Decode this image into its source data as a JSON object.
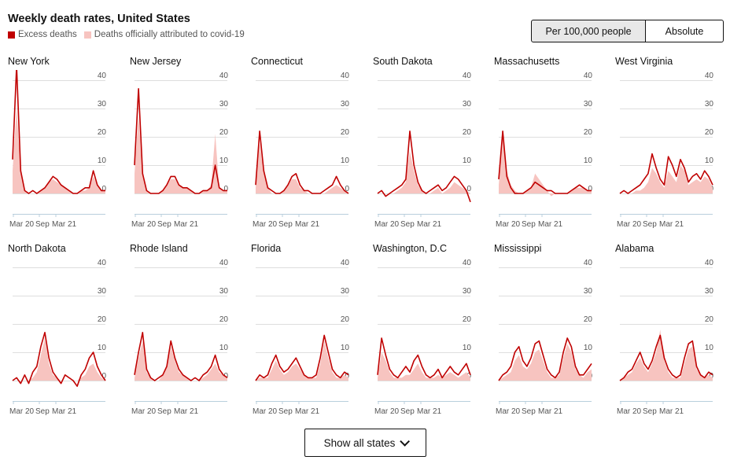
{
  "title": "Weekly death rates, United States",
  "legend": {
    "excess_label": "Excess deaths",
    "official_label": "Deaths officially attributed to covid-19"
  },
  "colors": {
    "excess": "#c00000",
    "official": "#f7c4c0",
    "grid": "#dedede",
    "axis": "#b9cfdc"
  },
  "toggle": {
    "per_label": "Per 100,000 people",
    "abs_label": "Absolute",
    "selected": "per"
  },
  "show_all_label": "Show all states",
  "chart_data": {
    "type": "line",
    "xlabel": "",
    "ylabel": "",
    "ylim": [
      -3,
      40
    ],
    "yticks": [
      0,
      10,
      20,
      30,
      40
    ],
    "xticks": [
      "Mar 20",
      "Sep",
      "Mar 21"
    ],
    "x": [
      "2020-03",
      "2020-04",
      "2020-05",
      "2020-06",
      "2020-07",
      "2020-08",
      "2020-09",
      "2020-10",
      "2020-11",
      "2020-12",
      "2021-01",
      "2021-02",
      "2021-03",
      "2021-04",
      "2021-05",
      "2021-06",
      "2021-07",
      "2021-08",
      "2021-09",
      "2021-10",
      "2021-11",
      "2021-12",
      "2022-01",
      "2022-02"
    ],
    "panels": [
      {
        "name": "New York",
        "series": [
          {
            "name": "Excess deaths",
            "values": [
              12,
              45,
              8,
              1,
              0,
              1,
              0,
              1,
              2,
              4,
              6,
              5,
              3,
              2,
              1,
              0,
              0,
              1,
              2,
              2,
              8,
              3,
              1,
              1
            ]
          },
          {
            "name": "Deaths officially attributed to covid-19",
            "values": [
              8,
              30,
              7,
              1,
              0,
              0,
              0,
              1,
              2,
              4,
              5,
              4,
              3,
              2,
              1,
              0,
              0,
              1,
              1,
              2,
              6,
              3,
              1,
              1
            ]
          }
        ]
      },
      {
        "name": "New Jersey",
        "series": [
          {
            "name": "Excess deaths",
            "values": [
              10,
              37,
              7,
              1,
              0,
              0,
              0,
              1,
              3,
              6,
              6,
              3,
              2,
              2,
              1,
              0,
              0,
              1,
              1,
              2,
              10,
              2,
              1,
              1
            ]
          },
          {
            "name": "Deaths officially attributed to covid-19",
            "values": [
              7,
              28,
              6,
              1,
              0,
              0,
              0,
              1,
              3,
              5,
              5,
              3,
              2,
              2,
              1,
              0,
              0,
              1,
              1,
              3,
              21,
              2,
              1,
              1
            ]
          }
        ]
      },
      {
        "name": "Connecticut",
        "series": [
          {
            "name": "Excess deaths",
            "values": [
              3,
              22,
              8,
              2,
              1,
              0,
              0,
              1,
              3,
              6,
              7,
              3,
              1,
              1,
              0,
              0,
              0,
              1,
              2,
              3,
              6,
              3,
              1,
              0
            ]
          },
          {
            "name": "Deaths officially attributed to covid-19",
            "values": [
              2,
              18,
              7,
              2,
              0,
              0,
              0,
              1,
              3,
              5,
              5,
              2,
              1,
              0,
              0,
              0,
              0,
              0,
              1,
              2,
              3,
              2,
              1,
              0
            ]
          }
        ]
      },
      {
        "name": "South Dakota",
        "series": [
          {
            "name": "Excess deaths",
            "values": [
              0,
              1,
              -1,
              0,
              1,
              2,
              3,
              5,
              22,
              10,
              4,
              1,
              0,
              1,
              2,
              3,
              1,
              2,
              4,
              6,
              5,
              3,
              1,
              -3
            ]
          },
          {
            "name": "Deaths officially attributed to covid-19",
            "values": [
              0,
              0,
              0,
              0,
              0,
              1,
              2,
              4,
              15,
              8,
              3,
              1,
              0,
              0,
              1,
              2,
              0,
              1,
              2,
              4,
              3,
              2,
              1,
              0
            ]
          }
        ]
      },
      {
        "name": "Massachusetts",
        "series": [
          {
            "name": "Excess deaths",
            "values": [
              5,
              22,
              6,
              2,
              0,
              0,
              0,
              1,
              2,
              4,
              3,
              2,
              1,
              1,
              0,
              0,
              0,
              0,
              1,
              2,
              3,
              2,
              1,
              1
            ]
          },
          {
            "name": "Deaths officially attributed to covid-19",
            "values": [
              3,
              20,
              8,
              3,
              1,
              0,
              0,
              1,
              2,
              7,
              5,
              3,
              1,
              -1,
              0,
              0,
              0,
              0,
              1,
              2,
              2,
              2,
              1,
              1
            ]
          }
        ]
      },
      {
        "name": "West Virginia",
        "series": [
          {
            "name": "Excess deaths",
            "values": [
              0,
              1,
              0,
              1,
              2,
              3,
              5,
              7,
              14,
              9,
              5,
              3,
              13,
              10,
              6,
              12,
              9,
              4,
              6,
              7,
              5,
              8,
              6,
              3
            ]
          },
          {
            "name": "Deaths officially attributed to covid-19",
            "values": [
              0,
              0,
              0,
              0,
              1,
              1,
              2,
              4,
              9,
              7,
              4,
              2,
              8,
              6,
              4,
              10,
              8,
              3,
              4,
              5,
              4,
              6,
              5,
              2
            ]
          }
        ]
      },
      {
        "name": "North Dakota",
        "series": [
          {
            "name": "Excess deaths",
            "values": [
              0,
              1,
              -1,
              2,
              -1,
              3,
              5,
              12,
              17,
              8,
              3,
              1,
              -1,
              2,
              1,
              0,
              -2,
              2,
              4,
              8,
              10,
              5,
              2,
              0
            ]
          },
          {
            "name": "Deaths officially attributed to covid-19",
            "values": [
              0,
              0,
              0,
              0,
              0,
              1,
              3,
              9,
              15,
              6,
              2,
              1,
              0,
              0,
              0,
              0,
              0,
              1,
              2,
              5,
              6,
              3,
              1,
              0
            ]
          }
        ]
      },
      {
        "name": "Rhode Island",
        "series": [
          {
            "name": "Excess deaths",
            "values": [
              2,
              10,
              17,
              4,
              1,
              0,
              1,
              2,
              5,
              14,
              8,
              4,
              2,
              1,
              0,
              1,
              0,
              2,
              3,
              5,
              9,
              4,
              2,
              1
            ]
          },
          {
            "name": "Deaths officially attributed to covid-19",
            "values": [
              1,
              8,
              14,
              3,
              1,
              0,
              0,
              2,
              5,
              12,
              7,
              3,
              2,
              1,
              0,
              0,
              0,
              1,
              2,
              4,
              6,
              3,
              2,
              1
            ]
          }
        ]
      },
      {
        "name": "Florida",
        "series": [
          {
            "name": "Excess deaths",
            "values": [
              0,
              2,
              1,
              2,
              6,
              9,
              5,
              3,
              4,
              6,
              8,
              5,
              2,
              1,
              1,
              2,
              8,
              16,
              10,
              4,
              2,
              1,
              3,
              2
            ]
          },
          {
            "name": "Deaths officially attributed to covid-19",
            "values": [
              0,
              1,
              1,
              1,
              4,
              7,
              4,
              2,
              3,
              5,
              6,
              4,
              2,
              1,
              1,
              1,
              6,
              14,
              8,
              3,
              1,
              1,
              2,
              1
            ]
          }
        ]
      },
      {
        "name": "Washington, D.C",
        "series": [
          {
            "name": "Excess deaths",
            "values": [
              2,
              15,
              9,
              4,
              2,
              1,
              3,
              5,
              3,
              7,
              9,
              5,
              2,
              1,
              2,
              4,
              1,
              3,
              5,
              3,
              2,
              4,
              6,
              2
            ]
          },
          {
            "name": "Deaths officially attributed to covid-19",
            "values": [
              1,
              10,
              7,
              3,
              1,
              1,
              1,
              2,
              2,
              4,
              6,
              3,
              1,
              1,
              1,
              2,
              1,
              2,
              3,
              2,
              1,
              2,
              3,
              1
            ]
          }
        ]
      },
      {
        "name": "Mississippi",
        "series": [
          {
            "name": "Excess deaths",
            "values": [
              0,
              2,
              3,
              5,
              10,
              12,
              7,
              5,
              8,
              13,
              14,
              9,
              4,
              2,
              1,
              3,
              10,
              15,
              12,
              5,
              2,
              2,
              4,
              6
            ]
          },
          {
            "name": "Deaths officially attributed to covid-19",
            "values": [
              0,
              1,
              2,
              3,
              7,
              9,
              5,
              4,
              6,
              10,
              11,
              7,
              3,
              1,
              1,
              2,
              8,
              13,
              10,
              4,
              2,
              1,
              3,
              4
            ]
          }
        ]
      },
      {
        "name": "Alabama",
        "series": [
          {
            "name": "Excess deaths",
            "values": [
              0,
              1,
              3,
              4,
              7,
              10,
              6,
              4,
              7,
              12,
              16,
              8,
              4,
              2,
              1,
              2,
              8,
              13,
              14,
              5,
              2,
              1,
              3,
              2
            ]
          },
          {
            "name": "Deaths officially attributed to covid-19",
            "values": [
              0,
              1,
              2,
              3,
              6,
              8,
              5,
              3,
              6,
              10,
              18,
              7,
              3,
              1,
              1,
              1,
              6,
              11,
              12,
              4,
              2,
              1,
              2,
              1
            ]
          }
        ]
      }
    ]
  }
}
